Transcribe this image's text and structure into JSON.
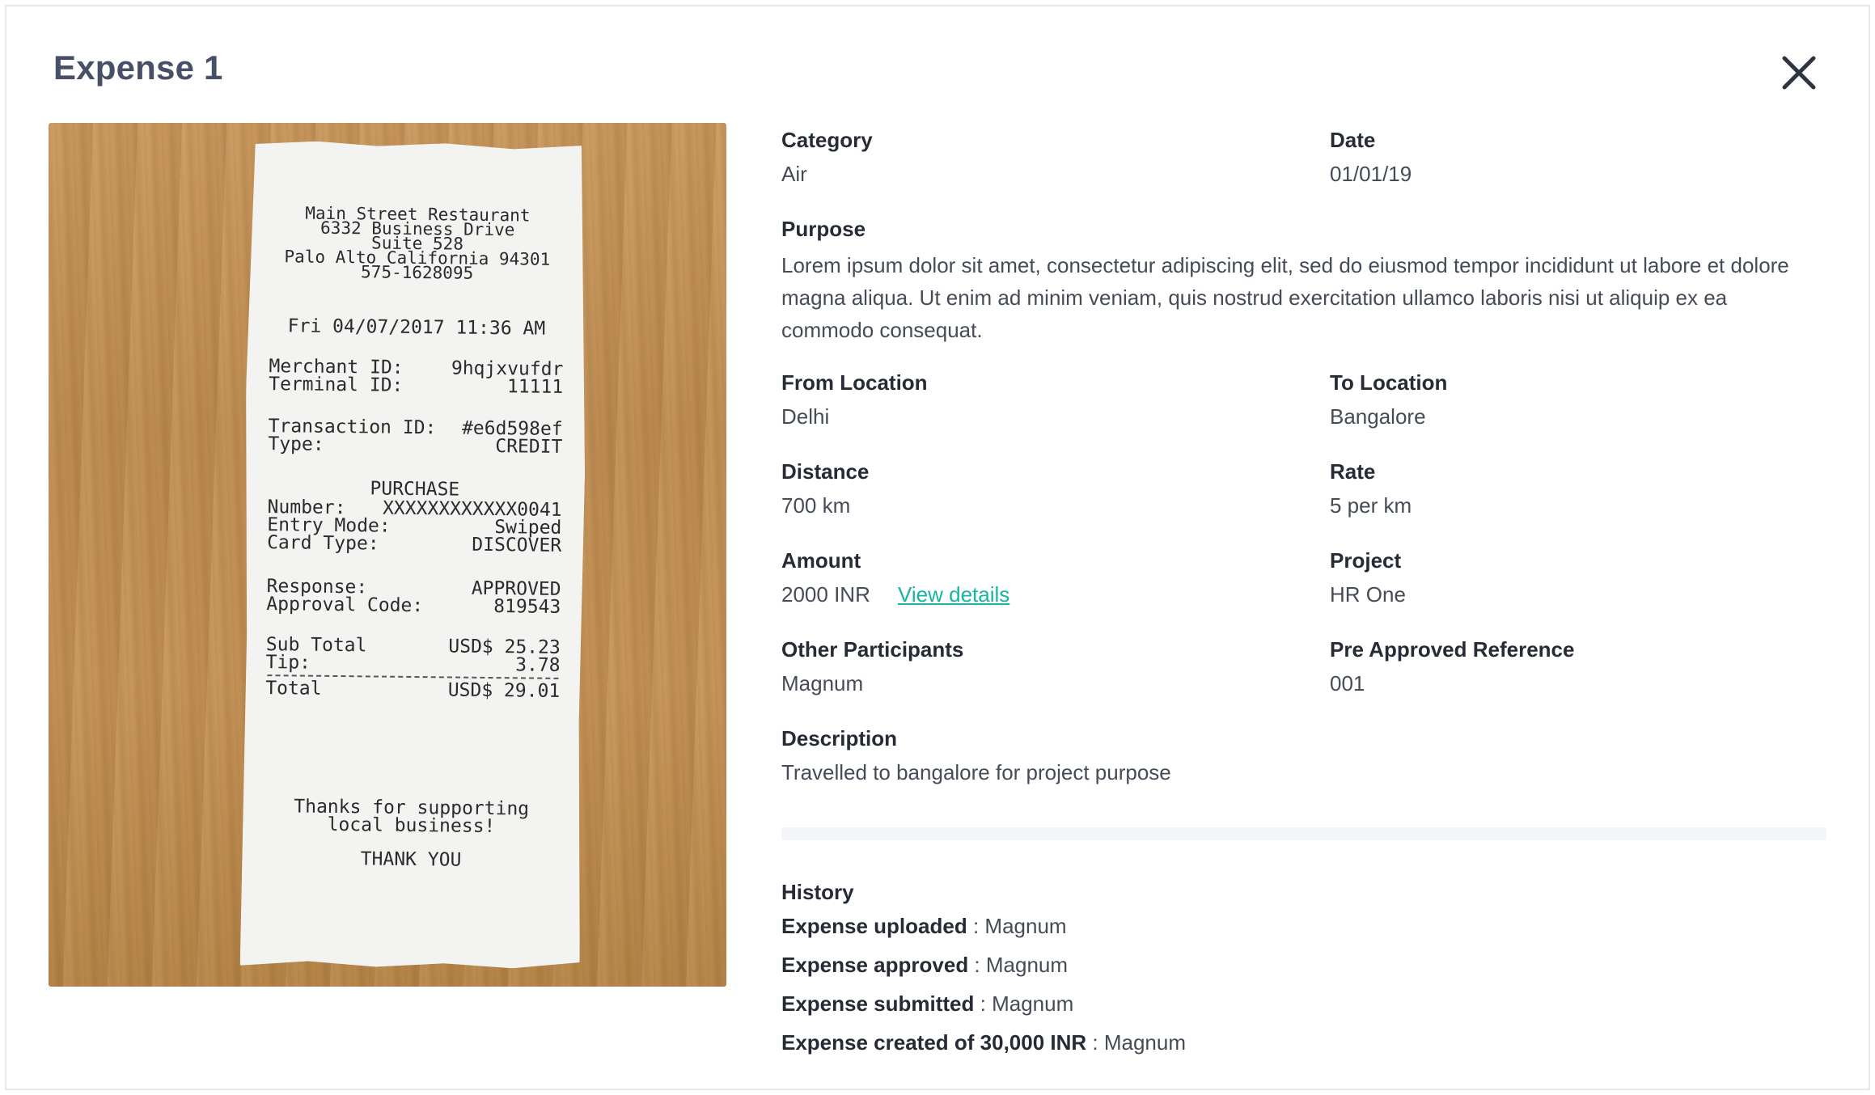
{
  "modal": {
    "title": "Expense 1",
    "close_icon": "close-icon"
  },
  "receipt": {
    "name": "Main Street Restaurant",
    "address1": "6332 Business Drive",
    "address2": "Suite 528",
    "city": "Palo Alto California 94301",
    "phone": "575-1628095",
    "datetime": "Fri 04/07/2017 11:36 AM",
    "merchant_label": "Merchant ID:",
    "merchant_value": "9hqjxvufdr",
    "terminal_label": "Terminal ID:",
    "terminal_value": "11111",
    "transaction_label": "Transaction ID:",
    "transaction_value": "#e6d598ef",
    "type_label": "Type:",
    "type_value": "CREDIT",
    "purchase": "PURCHASE",
    "number_label": "Number:",
    "number_value": "XXXXXXXXXXXX0041",
    "entry_label": "Entry Mode:",
    "entry_value": "Swiped",
    "card_label": "Card Type:",
    "card_value": "DISCOVER",
    "response_label": "Response:",
    "response_value": "APPROVED",
    "approval_label": "Approval Code:",
    "approval_value": "819543",
    "subtotal_label": "Sub Total",
    "subtotal_value": "USD$ 25.23",
    "tip_label": "Tip:",
    "tip_value": "3.78",
    "total_label": "Total",
    "total_value": "USD$ 29.01",
    "thanks1": "Thanks for supporting",
    "thanks2": "local business!",
    "thankyou": "THANK YOU"
  },
  "details": {
    "category_label": "Category",
    "category_value": "Air",
    "date_label": "Date",
    "date_value": "01/01/19",
    "purpose_label": "Purpose",
    "purpose_value": "Lorem ipsum dolor sit amet, consectetur adipiscing elit, sed do eiusmod tempor incididunt ut labore et dolore magna aliqua. Ut enim ad minim veniam, quis nostrud exercitation ullamco laboris nisi ut aliquip ex ea commodo consequat.",
    "from_label": "From Location",
    "from_value": "Delhi",
    "to_label": "To Location",
    "to_value": "Bangalore",
    "distance_label": "Distance",
    "distance_value": "700 km",
    "rate_label": "Rate",
    "rate_value": "5 per km",
    "amount_label": "Amount",
    "amount_value": "2000 INR",
    "view_details": "View details",
    "project_label": "Project",
    "project_value": "HR One",
    "participants_label": "Other Participants",
    "participants_value": "Magnum",
    "preapproved_label": "Pre Approved Reference",
    "preapproved_value": "001",
    "description_label": "Description",
    "description_value": "Travelled to bangalore for project purpose"
  },
  "history": {
    "label": "History",
    "items": [
      {
        "action": "Expense uploaded",
        "user": " : Magnum"
      },
      {
        "action": "Expense approved",
        "user": " : Magnum"
      },
      {
        "action": "Expense submitted",
        "user": " : Magnum"
      },
      {
        "action": "Expense created of 30,000 INR",
        "user": " : Magnum"
      }
    ]
  },
  "colors": {
    "title": "#475066",
    "link": "#19b3a3",
    "label": "#262b36",
    "value": "#454b57"
  }
}
